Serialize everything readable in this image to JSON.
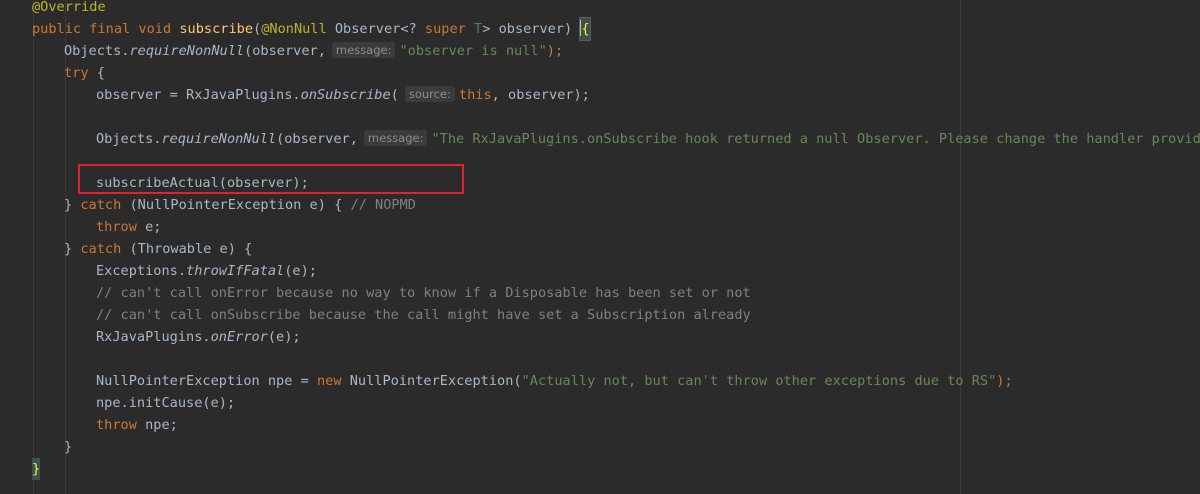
{
  "editor": {
    "lines": {
      "l1": {
        "annotation": "@Override"
      },
      "l2": {
        "kw_public": "public",
        "kw_final": "final",
        "kw_void": "void",
        "method": "subscribe",
        "open_paren": "(",
        "nonnull": "@NonNull",
        "type_observer": " Observer<? ",
        "kw_super": "super",
        "type_param": " T",
        "rest": "> observer) ",
        "brace": "{"
      },
      "l3": {
        "prefix": "Objects.",
        "call": "requireNonNull",
        "args": "(observer,",
        "hint": "message:",
        "str": "\"observer is null\"",
        "end": ");"
      },
      "l4": {
        "kw_try": "try",
        "rest": " {"
      },
      "l5": {
        "prefix": "observer = RxJavaPlugins.",
        "call": "onSubscribe",
        "paren": "(",
        "hint": "source:",
        "kw_this": "this",
        "rest": ", observer);"
      },
      "l6": {
        "prefix": "Objects.",
        "call": "requireNonNull",
        "args": "(observer,",
        "hint": "message:",
        "str": "\"The RxJavaPlugins.onSubscribe hook returned a null Observer. Please change the handler provided"
      },
      "l7": {
        "code": "subscribeActual(observer);"
      },
      "l8": {
        "brace": "} ",
        "kw_catch": "catch",
        "rest": " (NullPointerException e) { ",
        "comment": "// NOPMD"
      },
      "l9": {
        "kw_throw": "throw",
        "rest": " e;"
      },
      "l10": {
        "brace": "} ",
        "kw_catch": "catch",
        "rest": " (Throwable e) {"
      },
      "l11": {
        "prefix": "Exceptions.",
        "call": "throwIfFatal",
        "rest": "(e);"
      },
      "l12": {
        "comment": "// can't call onError because no way to know if a Disposable has been set or not"
      },
      "l13": {
        "comment": "// can't call onSubscribe because the call might have set a Subscription already"
      },
      "l14": {
        "prefix": "RxJavaPlugins.",
        "call": "onError",
        "rest": "(e);"
      },
      "l15": {
        "prefix": "NullPointerException npe = ",
        "kw_new": "new",
        "ctor": " NullPointerException(",
        "str": "\"Actually not, but can't throw other exceptions due to RS\"",
        "end": ");"
      },
      "l16": {
        "code": "npe.initCause(e);"
      },
      "l17": {
        "kw_throw": "throw",
        "rest": " npe;"
      },
      "l18": {
        "brace": "}"
      },
      "l19": {
        "brace": "}"
      }
    }
  },
  "colors": {
    "background": "#2b2b2b",
    "keyword": "#cc7832",
    "method": "#ffc66d",
    "annotation": "#bbb529",
    "string": "#6a8759",
    "comment": "#808080",
    "text": "#a9b7c6",
    "highlight_box": "#e0232e"
  }
}
